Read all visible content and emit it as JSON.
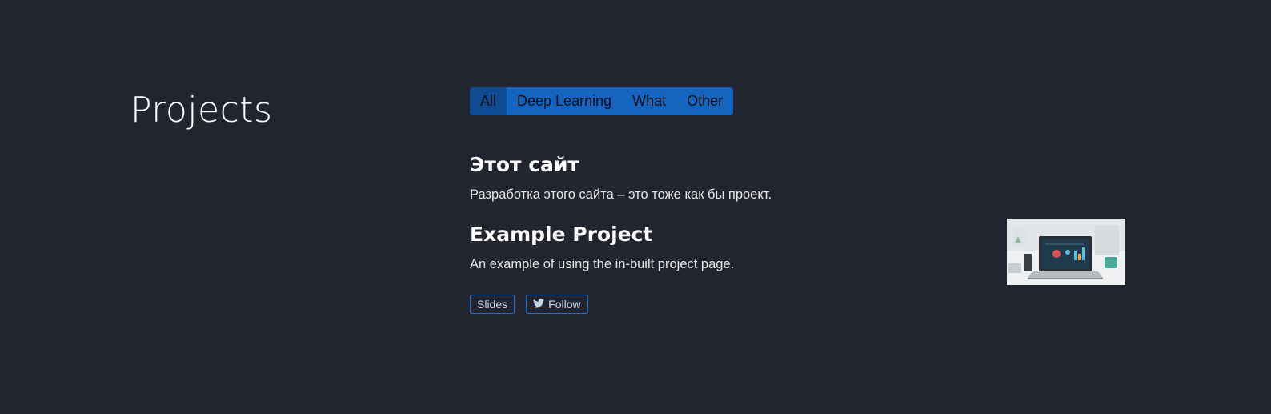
{
  "section": {
    "title": "Projects"
  },
  "filters": [
    {
      "label": "All",
      "active": true
    },
    {
      "label": "Deep Learning",
      "active": false
    },
    {
      "label": "What",
      "active": false
    },
    {
      "label": "Other",
      "active": false
    }
  ],
  "projects": [
    {
      "title": "Этот сайт",
      "summary": "Разработка этого сайта – это тоже как бы проект."
    },
    {
      "title": "Example Project",
      "summary": "An example of using the in-built project page.",
      "links": [
        {
          "label": "Slides",
          "icon": ""
        },
        {
          "label": "Follow",
          "icon": "twitter-icon"
        }
      ],
      "thumbnail": "laptop-dashboard-image"
    }
  ],
  "colors": {
    "background": "#22252f",
    "accent": "#1565c0",
    "accent_active": "#0f4c94"
  }
}
